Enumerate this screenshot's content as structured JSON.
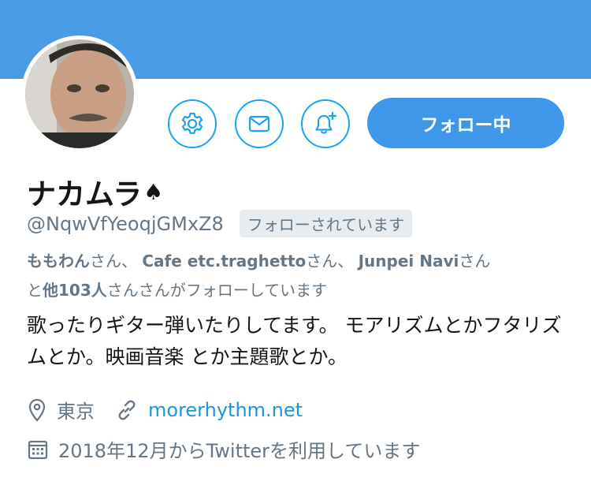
{
  "profile": {
    "name": "ナカムラ",
    "name_suffix": "♠",
    "handle": "@NqwVfYeoqjGMxZ8",
    "follows_you": "フォローされています",
    "follow_button": "フォロー中",
    "followed_by": {
      "user1": "ももわん",
      "san1": "さん、",
      "user2": "Cafe etc.traghetto",
      "san2": "さん、",
      "user3": "Junpei Navi",
      "san3": "さん",
      "and": "と",
      "others": "他103人",
      "suffix": "さんさんがフォローしています"
    },
    "bio": "歌ったりギター弾いたりしてます。 モアリズムとかフタリズムとか。映画音楽 とか主題歌とか。",
    "location": "東京",
    "website": "morerhythm.net",
    "joined": "2018年12月からTwitterを利用しています"
  },
  "icons": [
    "settings-gear-icon",
    "message-envelope-icon",
    "notification-bell-plus-icon",
    "location-pin-icon",
    "link-icon",
    "calendar-icon"
  ],
  "colors": {
    "banner": "#4a9be6",
    "accent": "#1da1f2",
    "follow_button": "#3e97e8",
    "muted": "#657786"
  }
}
